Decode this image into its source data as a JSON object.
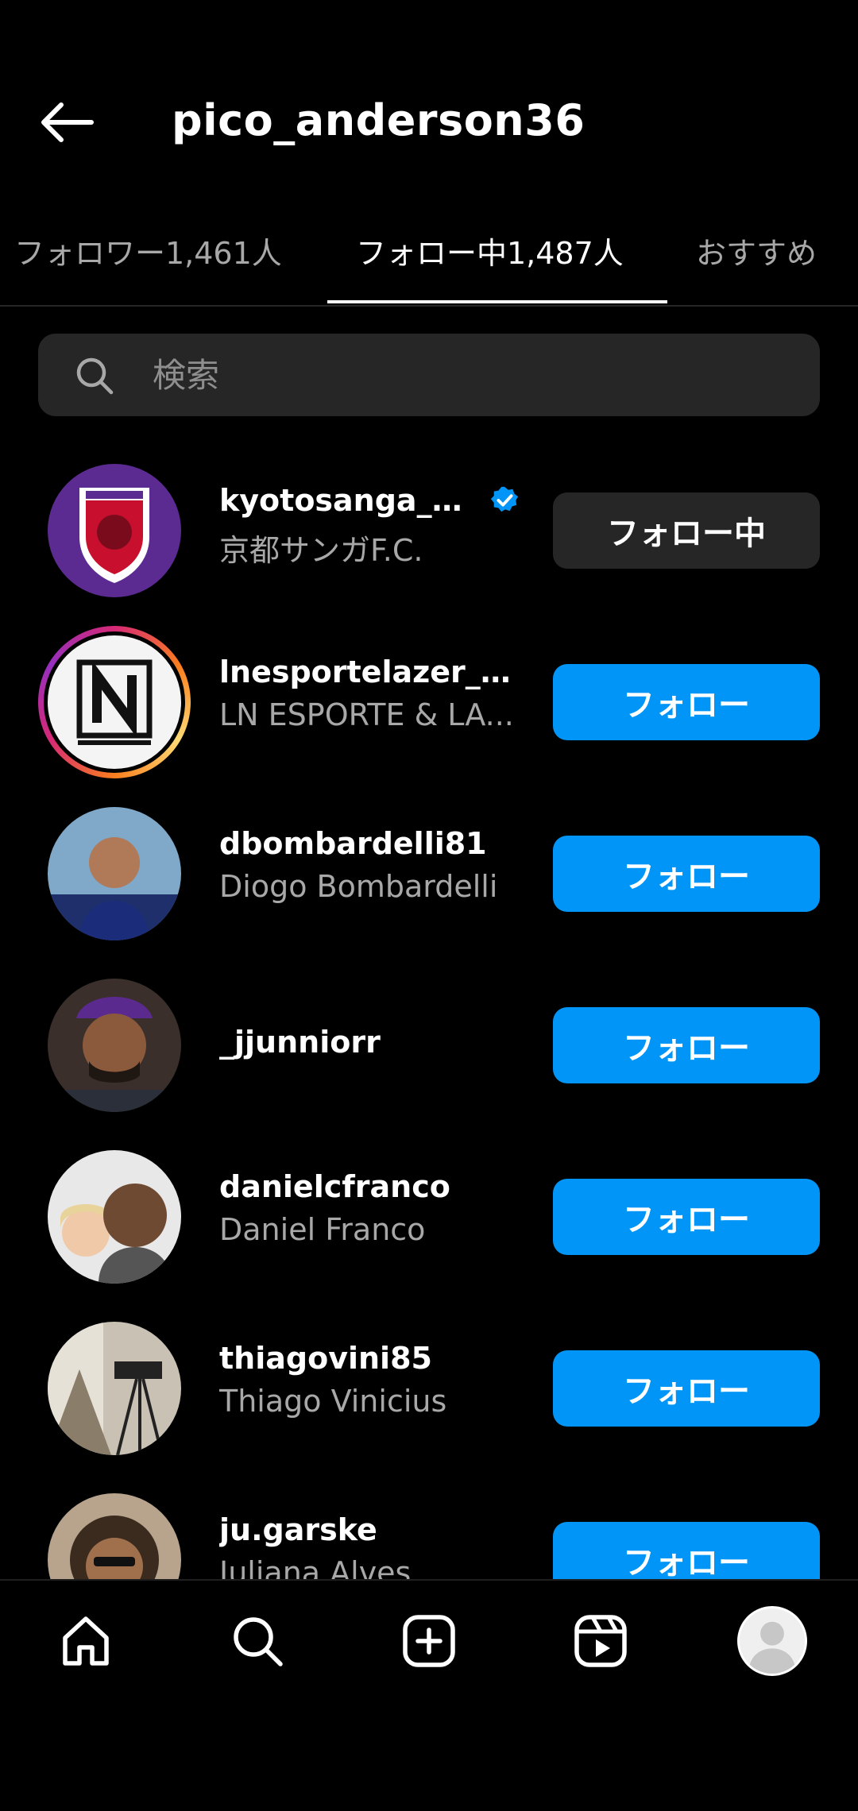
{
  "header": {
    "title": "pico_anderson36"
  },
  "tabs": [
    {
      "label": "フォロワー1,461人"
    },
    {
      "label": "フォロー中1,487人"
    },
    {
      "label": "おすすめ"
    }
  ],
  "search": {
    "placeholder": "検索"
  },
  "accounts": [
    {
      "username": "kyotosanga_offi...",
      "full_name": "京都サンガF.C.",
      "verified": true,
      "button": "フォロー中"
    },
    {
      "username": "lnesportelazer_glo...",
      "full_name": "LN ESPORTE & LA...",
      "verified": false,
      "button": "フォロー"
    },
    {
      "username": "dbombardelli81",
      "full_name": "Diogo Bombardelli",
      "verified": false,
      "button": "フォロー"
    },
    {
      "username": "_jjunniorr",
      "full_name": "",
      "verified": false,
      "button": "フォロー"
    },
    {
      "username": "danielcfranco",
      "full_name": "Daniel Franco",
      "verified": false,
      "button": "フォロー"
    },
    {
      "username": "thiagovini85",
      "full_name": "Thiago Vinicius",
      "verified": false,
      "button": "フォロー"
    },
    {
      "username": "ju.garske",
      "full_name": "Juliana Alves",
      "verified": false,
      "button": "フォロー"
    }
  ],
  "colors": {
    "primary_button": "#0095f6",
    "secondary_button": "#262626",
    "verified": "#0095f6"
  },
  "bottom_nav": [
    "home-icon",
    "search-icon",
    "create-icon",
    "reels-icon",
    "profile-avatar"
  ]
}
